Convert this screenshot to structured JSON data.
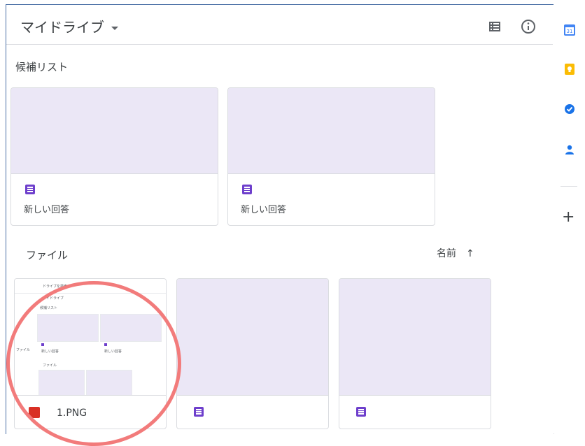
{
  "header": {
    "title": "マイドライブ"
  },
  "sections": {
    "suggested": "候補リスト",
    "files": "ファイル"
  },
  "sort": {
    "label": "名前",
    "arrow": "↑"
  },
  "suggested_cards": [
    {
      "name": "新しい回答"
    },
    {
      "name": "新しい回答"
    }
  ],
  "file_cards": [
    {
      "name": "1.PNG"
    },
    {
      "name": ""
    },
    {
      "name": ""
    }
  ],
  "mini": {
    "search": "ドライブを検索",
    "title": "マイドライブ",
    "suggested": "候補リスト",
    "files": "ファイル",
    "card_label": "新しい回答",
    "side": "ファイル"
  },
  "rail": {
    "calendar_day": "31",
    "plus": "+"
  },
  "colors": {
    "forms_purple": "#6e3fcc",
    "thumb_bg": "#ebe7f6",
    "annotation_circle": "#f27b7b",
    "image_red": "#d93025"
  }
}
